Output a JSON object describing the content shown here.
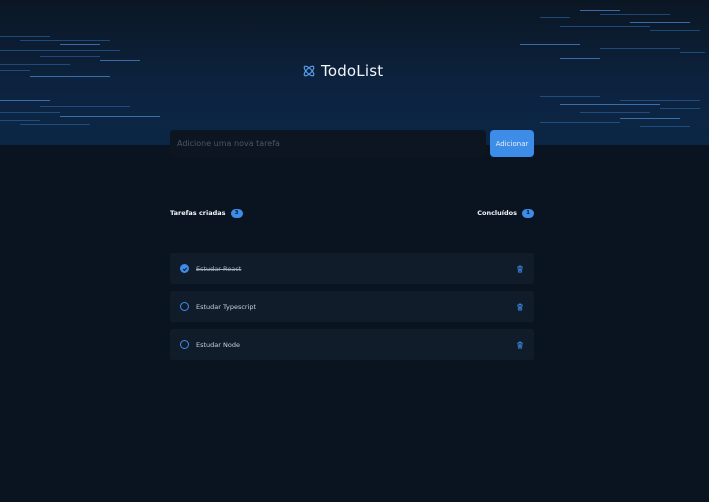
{
  "app": {
    "title": "TodoList",
    "icon": "atom-icon"
  },
  "new_task": {
    "placeholder": "Adicione uma nova tarefa",
    "value": "",
    "button_label": "Adicionar"
  },
  "counters": {
    "created_label": "Tarefas criadas",
    "created_count": "3",
    "completed_label": "Concluídos",
    "completed_count": "1"
  },
  "tasks": [
    {
      "text": "Estudar React",
      "done": true
    },
    {
      "text": "Estudar Typescript",
      "done": false
    },
    {
      "text": "Estudar Node",
      "done": false
    }
  ],
  "colors": {
    "background": "#0a1420",
    "accent": "#3d8ce8",
    "card": "#111c2b"
  }
}
